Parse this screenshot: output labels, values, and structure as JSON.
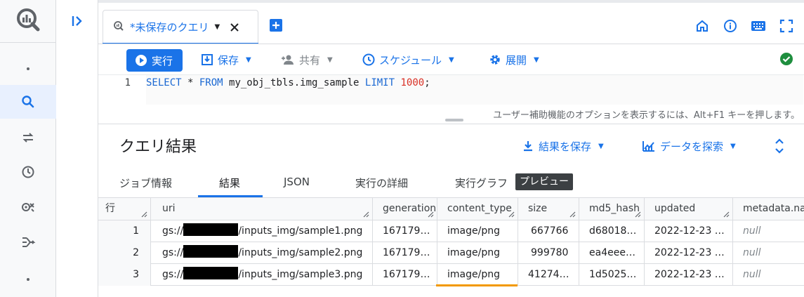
{
  "tab": {
    "label": "*未保存のクエリ"
  },
  "toolbar": {
    "run_label": "実行",
    "save_label": "保存",
    "share_label": "共有",
    "schedule_label": "スケジュール",
    "deploy_label": "展開"
  },
  "editor": {
    "line_number": "1",
    "tokens": {
      "k1": "SELECT",
      "t1": " * ",
      "k2": "FROM",
      "t2": " my_obj_tbls.img_sample ",
      "k3": "LIMIT",
      "t3": " ",
      "n1": "1000",
      "t4": ";"
    },
    "a11y_hint": "ユーザー補助機能のオプションを表示するには、Alt+F1 キーを押します。"
  },
  "results": {
    "title": "クエリ結果",
    "save_results_label": "結果を保存",
    "explore_label": "データを探索",
    "tabs": [
      "ジョブ情報",
      "結果",
      "JSON",
      "実行の詳細",
      "実行グラフ"
    ],
    "preview_badge": "プレビュー"
  },
  "table": {
    "headers": [
      "行",
      "uri",
      "generation",
      "content_type",
      "size",
      "md5_hash",
      "updated",
      "metadata.name"
    ],
    "rows": [
      {
        "n": "1",
        "uri_prefix": "gs://",
        "uri_suffix": "/inputs_img/sample1.png",
        "generation": "167179…",
        "content_type": "image/png",
        "size": "667766",
        "md5": "d68018…",
        "updated": "2022-12-23 …",
        "meta": "null"
      },
      {
        "n": "2",
        "uri_prefix": "gs://",
        "uri_suffix": "/inputs_img/sample2.png",
        "generation": "167179…",
        "content_type": "image/png",
        "size": "999780",
        "md5": "ea4eee…",
        "updated": "2022-12-23 …",
        "meta": "null"
      },
      {
        "n": "3",
        "uri_prefix": "gs://",
        "uri_suffix": "/inputs_img/sample3.png",
        "generation": "167179…",
        "content_type": "image/png",
        "size": "41274…",
        "md5": "1d5025…",
        "updated": "2022-12-23 …",
        "meta": "null"
      }
    ]
  },
  "colors": {
    "accent": "#1a73e8",
    "success": "#1e8e3e",
    "highlight": "#f29900"
  }
}
